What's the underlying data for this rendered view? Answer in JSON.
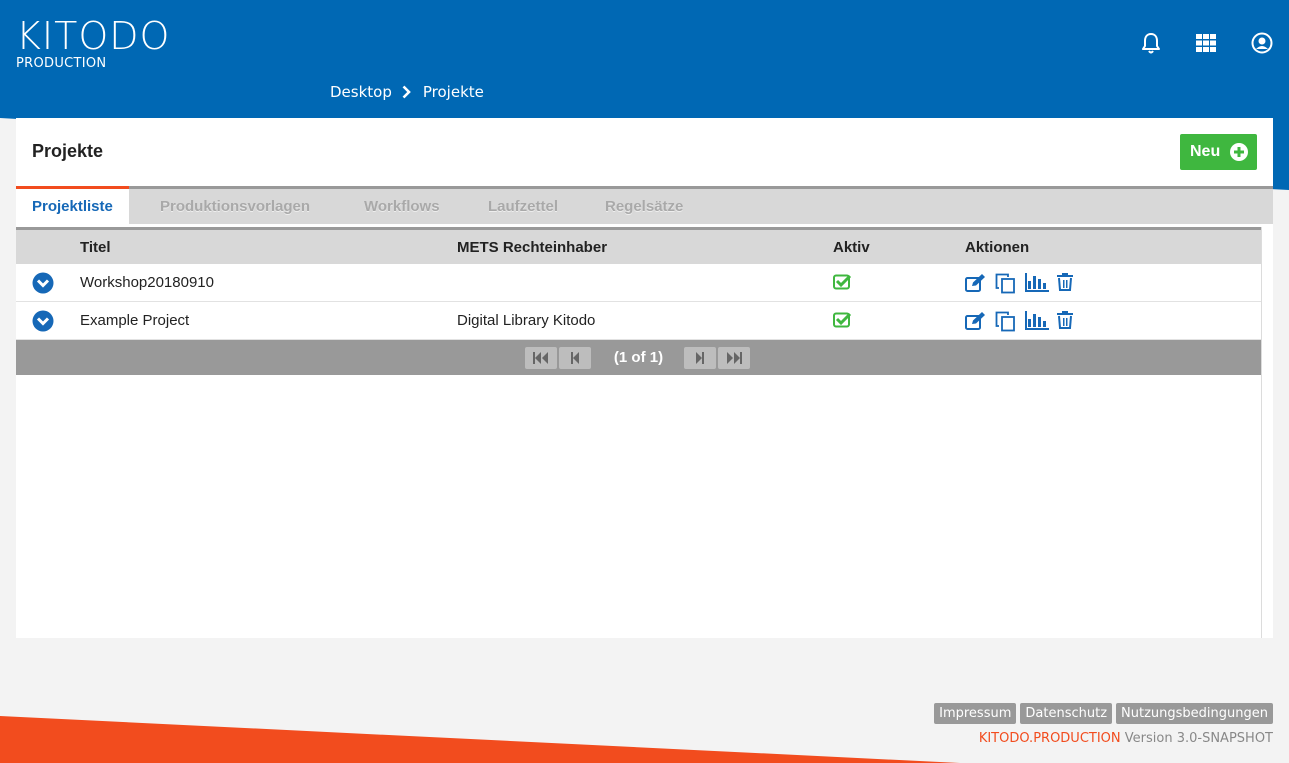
{
  "colors": {
    "primary_blue": "#0068b4",
    "accent_orange": "#f24c1e",
    "success_green": "#3fb73f",
    "action_blue": "#1668b7"
  },
  "header": {
    "logo_main": "KITODO",
    "logo_sub": "PRODUCTION",
    "icons": [
      "bell-icon",
      "apps-grid-icon",
      "user-icon"
    ]
  },
  "breadcrumb": {
    "items": [
      "Desktop",
      "Projekte"
    ]
  },
  "panel": {
    "title": "Projekte",
    "new_button": "Neu"
  },
  "tabs": [
    {
      "label": "Projektliste",
      "active": true
    },
    {
      "label": "Produktionsvorlagen",
      "active": false
    },
    {
      "label": "Workflows",
      "active": false
    },
    {
      "label": "Laufzettel",
      "active": false
    },
    {
      "label": "Regelsätze",
      "active": false
    }
  ],
  "table": {
    "columns": [
      "Titel",
      "METS Rechteinhaber",
      "Aktiv",
      "Aktionen"
    ],
    "rows": [
      {
        "title": "Workshop20180910",
        "rights_holder": "",
        "active": true
      },
      {
        "title": "Example Project",
        "rights_holder": "Digital Library Kitodo",
        "active": true
      }
    ],
    "action_icons": [
      "edit-icon",
      "duplicate-icon",
      "statistics-icon",
      "delete-icon"
    ]
  },
  "paginator": {
    "info": "(1 of 1)"
  },
  "footer": {
    "links": [
      "Impressum",
      "Datenschutz",
      "Nutzungsbedingungen"
    ],
    "brand": "KITODO.PRODUCTION",
    "version": "Version 3.0-SNAPSHOT"
  }
}
